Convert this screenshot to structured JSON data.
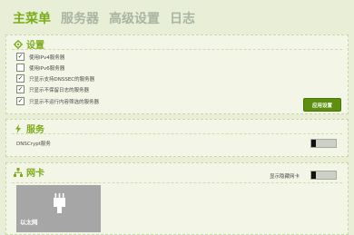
{
  "tabs": [
    {
      "label": "主菜单",
      "active": true
    },
    {
      "label": "服务器",
      "active": false
    },
    {
      "label": "高级设置",
      "active": false
    },
    {
      "label": "日志",
      "active": false
    }
  ],
  "settings": {
    "title": "设置",
    "options": [
      {
        "label": "使用IPv4服务器",
        "checked": true
      },
      {
        "label": "使用IPv6服务器",
        "checked": false
      },
      {
        "label": "只显示支持DNSSEC的服务器",
        "checked": true
      },
      {
        "label": "只显示不保留日志的服务器",
        "checked": true
      },
      {
        "label": "只显示不运行内容筛选的服务器",
        "checked": true
      }
    ],
    "apply_label": "应用设置",
    "check_glyph": "✓"
  },
  "service": {
    "title": "服务",
    "dnscrypt_label": "DNSCrypt服务",
    "dnscrypt_on": false
  },
  "nic": {
    "title": "网卡",
    "show_hidden_label": "显示隐藏网卡",
    "show_hidden_on": false,
    "card_name": "以太网"
  },
  "colors": {
    "accent": "#7bad1a",
    "button": "#5c8f0f",
    "background": "#e8efd6",
    "panel": "#f3f6e6",
    "card": "#a6a6a6"
  }
}
